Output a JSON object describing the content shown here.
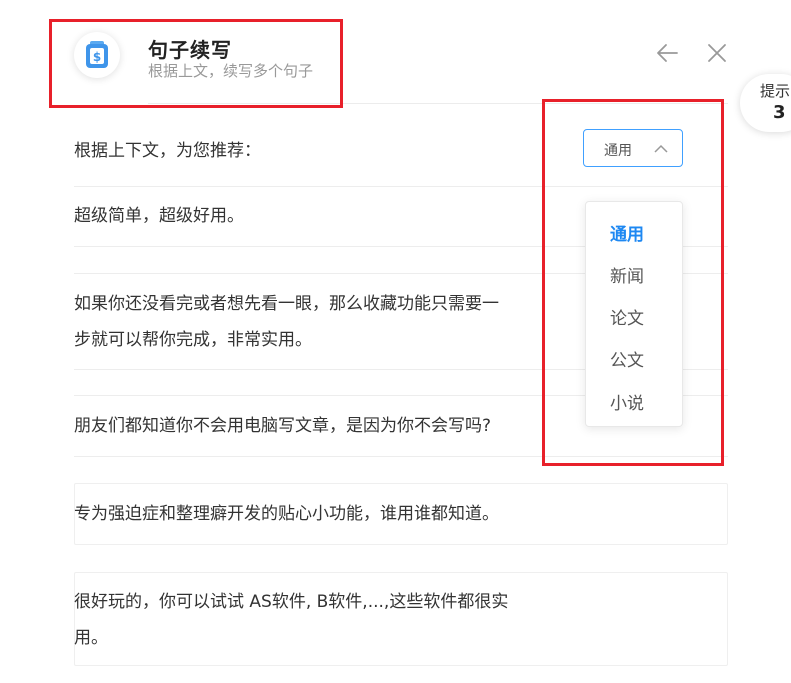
{
  "header": {
    "title": "句子续写",
    "subtitle": "根据上文，续写多个句子"
  },
  "hint": {
    "label": "提示",
    "count": "3"
  },
  "prompt": "根据上下文，为您推荐：",
  "select": {
    "value": "通用",
    "options": [
      "通用",
      "新闻",
      "论文",
      "公文",
      "小说"
    ]
  },
  "sentences": [
    "超级简单，超级好用。",
    "如果你还没看完或者想先看一眼，那么收藏功能只需要一\n步就可以帮你完成，非常实用。",
    "朋友们都知道你不会用电脑写文章，是因为你不会写吗?",
    "专为强迫症和整理癖开发的贴心小功能，谁用谁都知道。",
    "很好玩的，你可以试试 AS软件, B软件,...,这些软件都很实\n用。"
  ],
  "colors": {
    "accent": "#1e88f2",
    "highlight_border": "#e8202a",
    "select_border": "#40a0ff"
  }
}
